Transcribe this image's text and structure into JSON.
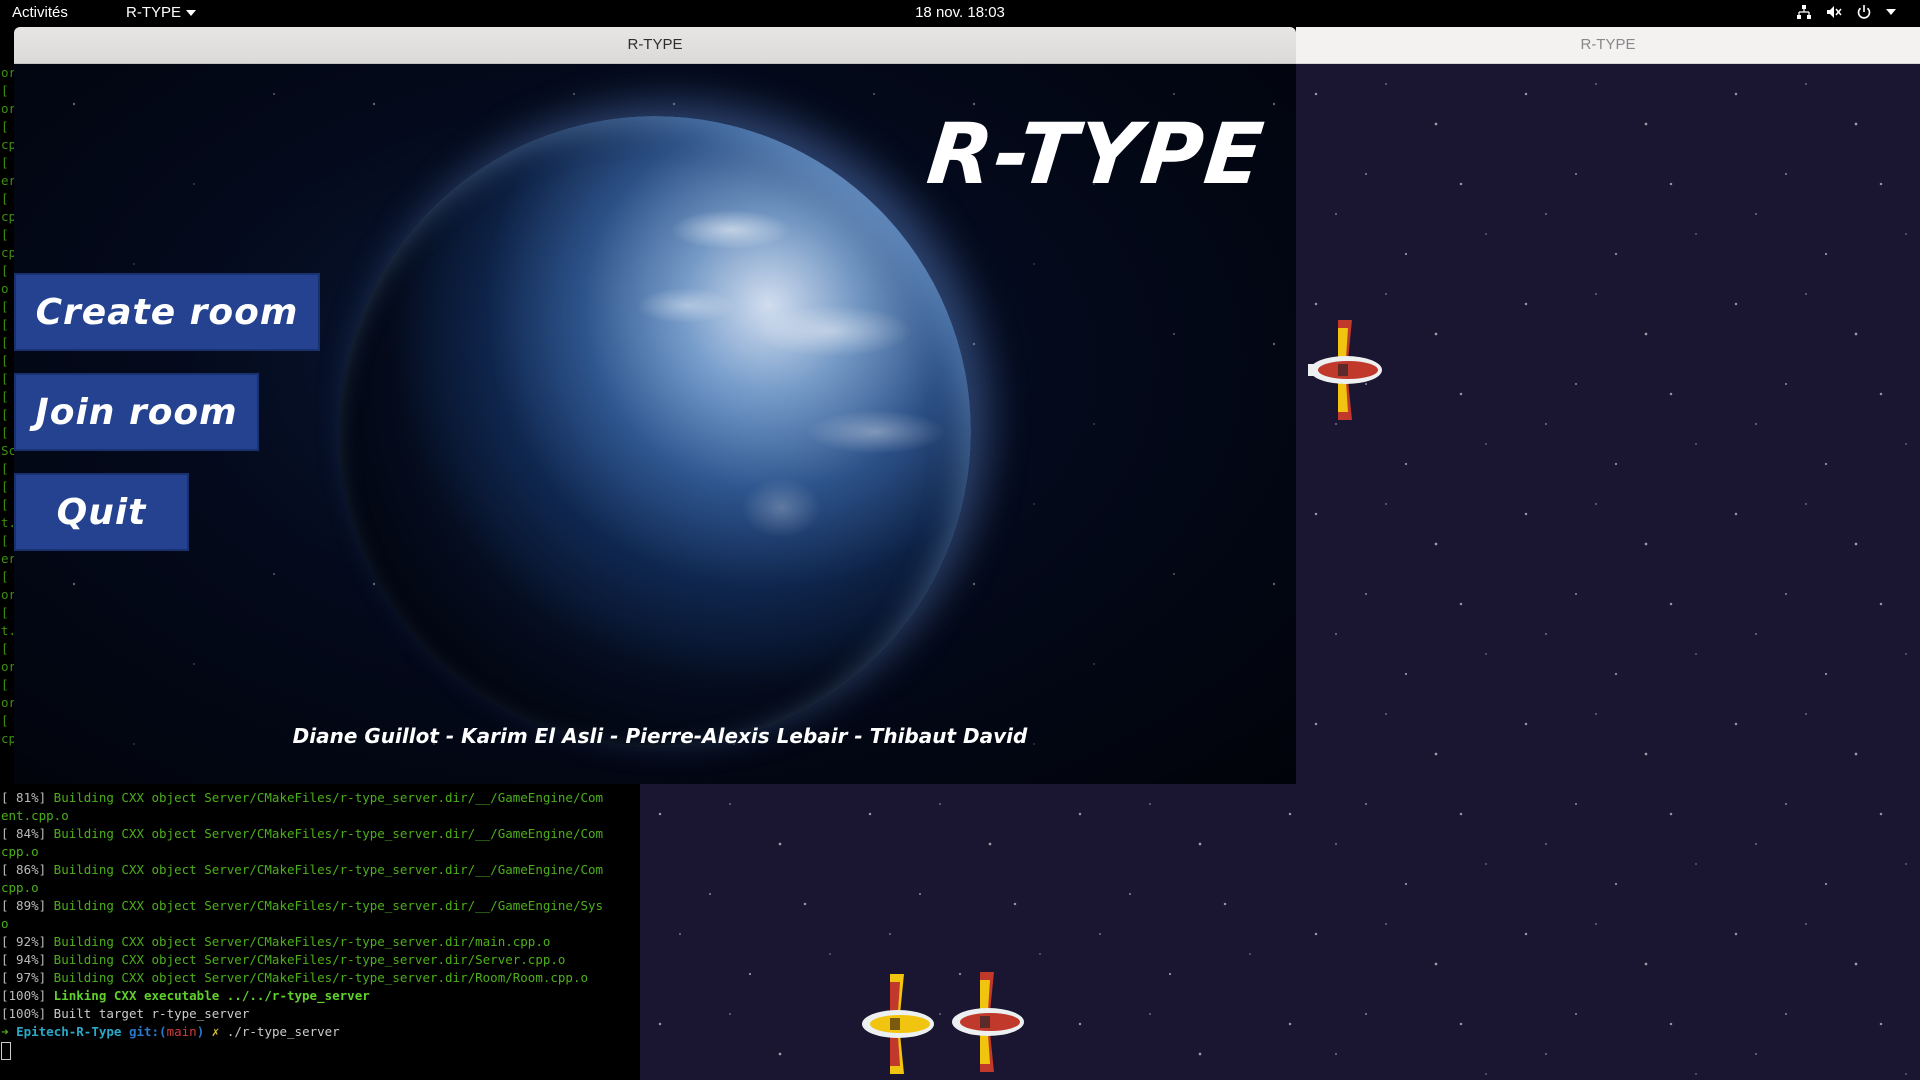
{
  "topbar": {
    "activities": "Activités",
    "app_name": "R-TYPE",
    "clock": "18 nov.  18:03",
    "tray_icons": [
      "network-icon",
      "volume-muted-icon",
      "power-icon"
    ]
  },
  "main_window": {
    "title": "R-TYPE",
    "game": {
      "logo": "R-TYPE",
      "buttons": {
        "create": "Create room",
        "join": "Join room",
        "quit": "Quit"
      },
      "credits": "Diane Guillot - Karim El Asli - Pierre-Alexis Lebair - Thibaut David"
    }
  },
  "second_window": {
    "title": "R-TYPE"
  },
  "terminal": {
    "gutter": [
      "or",
      "[",
      "or",
      "[",
      "cp",
      "[",
      "er",
      "[",
      "cp",
      "[",
      "cp",
      "[",
      "o",
      "[",
      "[",
      "[",
      "[",
      "[",
      "[",
      "[",
      "[",
      "Sc",
      "[",
      "[",
      "[",
      "t.",
      "[",
      "er",
      "[",
      "or",
      "[",
      "t.",
      "[",
      "or",
      "[",
      "or",
      "[",
      "cp"
    ],
    "lines": [
      {
        "pct": "[ 81%]",
        "text": " Building CXX object Server/CMakeFiles/r-type_server.dir/__/GameEngine/Com"
      },
      {
        "pct": "",
        "text": "ent.cpp.o"
      },
      {
        "pct": "[ 84%]",
        "text": " Building CXX object Server/CMakeFiles/r-type_server.dir/__/GameEngine/Com"
      },
      {
        "pct": "",
        "text": "cpp.o"
      },
      {
        "pct": "[ 86%]",
        "text": " Building CXX object Server/CMakeFiles/r-type_server.dir/__/GameEngine/Com"
      },
      {
        "pct": "",
        "text": "cpp.o"
      },
      {
        "pct": "[ 89%]",
        "text": " Building CXX object Server/CMakeFiles/r-type_server.dir/__/GameEngine/Sys"
      },
      {
        "pct": "",
        "text": "o"
      },
      {
        "pct": "[ 92%]",
        "text": " Building CXX object Server/CMakeFiles/r-type_server.dir/main.cpp.o"
      },
      {
        "pct": "[ 94%]",
        "text": " Building CXX object Server/CMakeFiles/r-type_server.dir/Server.cpp.o"
      },
      {
        "pct": "[ 97%]",
        "text": " Building CXX object Server/CMakeFiles/r-type_server.dir/Room/Room.cpp.o"
      }
    ],
    "linking": {
      "pct": "[100%]",
      "text": " Linking CXX executable ../../r-type_server"
    },
    "built": {
      "pct": "[100%]",
      "text": " Built target r-type_server"
    },
    "prompt": {
      "arrow": "➜",
      "dir": "Epitech-R-Type",
      "git_label": "git:(",
      "branch": "main",
      "git_close": ")",
      "dirty": "✗",
      "command": "./r-type_server"
    }
  },
  "colors": {
    "button_bg": "#24428f",
    "terminal_green": "#4caf1a",
    "space_bg": "#1a1530"
  }
}
